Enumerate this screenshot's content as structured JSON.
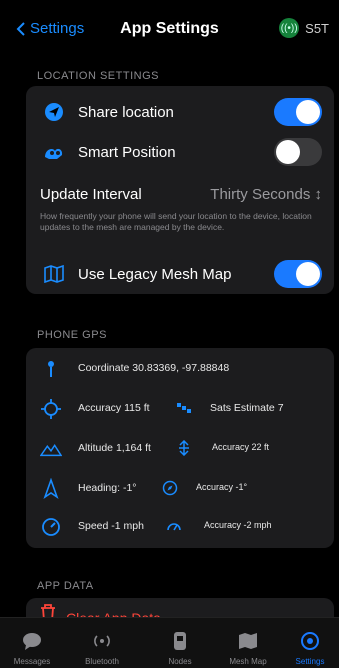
{
  "header": {
    "back_label": "Settings",
    "title": "App Settings",
    "node_name": "S5T",
    "node_short": "((•))"
  },
  "location_settings": {
    "section_title": "LOCATION SETTINGS",
    "share_location_label": "Share location",
    "share_location_on": true,
    "smart_position_label": "Smart Position",
    "smart_position_on": false,
    "update_interval_label": "Update Interval",
    "update_interval_value": "Thirty Seconds",
    "update_interval_hint": "How frequently your phone will send your location to the device, location updates to the mesh are managed by the device.",
    "legacy_map_label": "Use Legacy Mesh Map",
    "legacy_map_on": true
  },
  "phone_gps": {
    "section_title": "PHONE GPS",
    "coordinate": "Coordinate 30.83369, -97.88848",
    "accuracy": "Accuracy 115 ft",
    "sats": "Sats Estimate 7",
    "altitude": "Altitude 1,164 ft",
    "altitude_accuracy": "Accuracy 22 ft",
    "heading": "Heading: -1°",
    "heading_accuracy": "Accuracy -1°",
    "speed": "Speed -1 mph",
    "speed_accuracy": "Accuracy -2 mph"
  },
  "app_data": {
    "section_title": "APP DATA",
    "clear_label": "Clear App Data"
  },
  "tabbar": {
    "messages": "Messages",
    "bluetooth": "Bluetooth",
    "nodes": "Nodes",
    "mesh_map": "Mesh Map",
    "settings": "Settings",
    "active": "settings"
  },
  "colors": {
    "accent": "#1a7aff",
    "destructive": "#ff453a",
    "node_badge": "#15823b"
  }
}
